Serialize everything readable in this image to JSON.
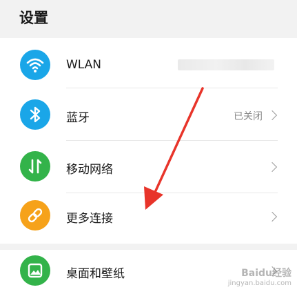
{
  "header": {
    "title": "设置"
  },
  "items": [
    {
      "label": "WLAN",
      "value": "",
      "icon": "wifi-icon",
      "color": "#1aa6e8"
    },
    {
      "label": "蓝牙",
      "value": "已关闭",
      "icon": "bluetooth-icon",
      "color": "#1aa6e8"
    },
    {
      "label": "移动网络",
      "value": "",
      "icon": "mobile-network-icon",
      "color": "#33b34a"
    },
    {
      "label": "更多连接",
      "value": "",
      "icon": "link-icon",
      "color": "#f6a21a"
    },
    {
      "label": "桌面和壁纸",
      "value": "",
      "icon": "wallpaper-icon",
      "color": "#33b34a"
    }
  ],
  "watermark": {
    "line1": "Baidu经验",
    "line2": "jingyan.baidu.com"
  },
  "annotation": {
    "arrow_color": "#e8342a"
  }
}
